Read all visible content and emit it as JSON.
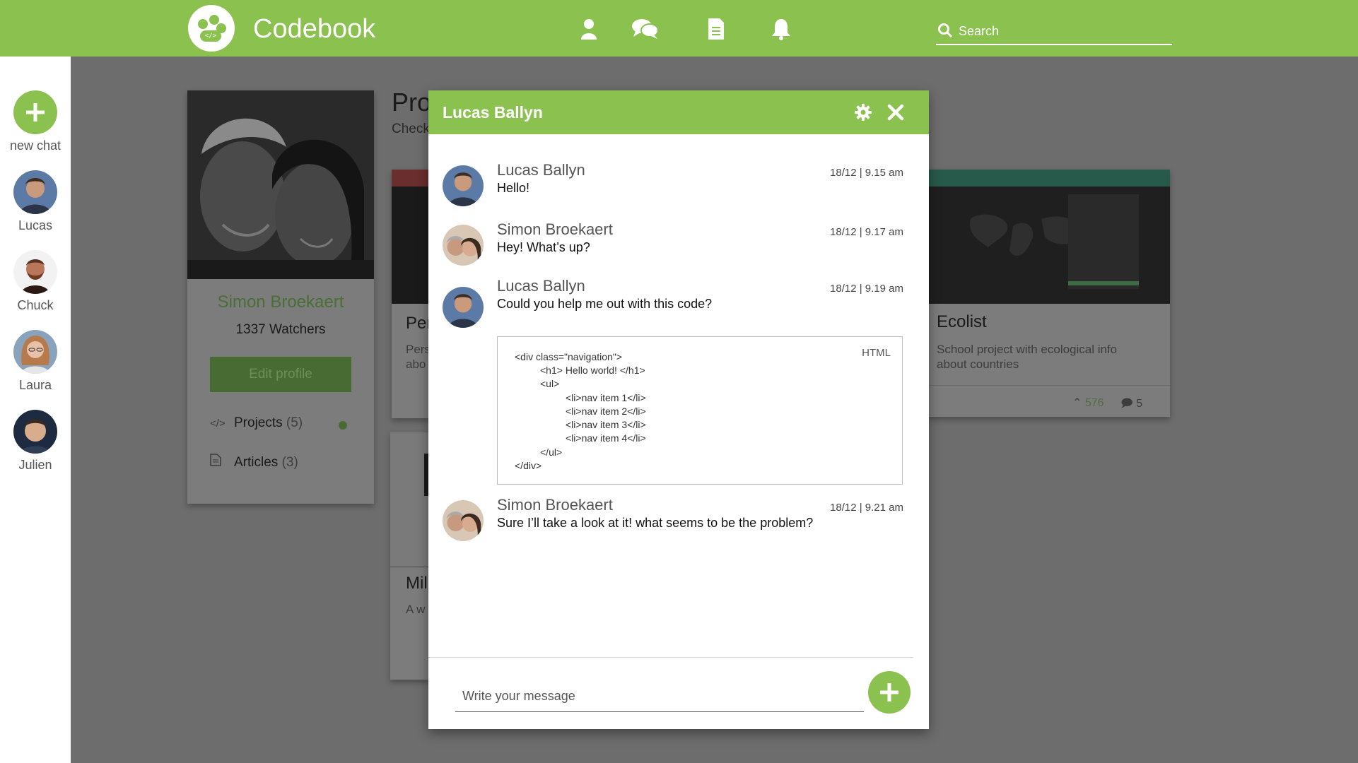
{
  "app": {
    "name": "Codebook"
  },
  "header": {
    "icons": [
      "user-icon",
      "chat-bubbles-icon",
      "document-icon",
      "bell-icon"
    ],
    "search_placeholder": "Search"
  },
  "sidebar": {
    "new_chat_label": "new chat",
    "contacts": [
      {
        "name": "Lucas"
      },
      {
        "name": "Chuck"
      },
      {
        "name": "Laura"
      },
      {
        "name": "Julien"
      }
    ]
  },
  "profile": {
    "name": "Simon Broekaert",
    "watchers": "1337 Watchers",
    "edit_label": "Edit profile",
    "menu": [
      {
        "label": "Projects",
        "count": "(5)"
      },
      {
        "label": "Articles",
        "count": "(3)"
      }
    ]
  },
  "page": {
    "title_visible": "Pro",
    "subtitle_visible": "Check"
  },
  "cards": [
    {
      "title_visible": "Per",
      "desc_visible": [
        "Pers",
        "abo"
      ]
    },
    {
      "title": "Ecolist",
      "desc": [
        "School project with ecological info",
        "about countries"
      ],
      "likes": "576",
      "comments": "5"
    },
    {
      "title_visible": "Mil",
      "desc_visible": "A w"
    }
  ],
  "chat": {
    "title": "Lucas Ballyn",
    "messages": [
      {
        "sender": "Lucas Ballyn",
        "time": "18/12 | 9.15 am",
        "text": "Hello!"
      },
      {
        "sender": "Simon Broekaert",
        "time": "18/12 | 9.17 am",
        "text": "Hey! What’s up?"
      },
      {
        "sender": "Lucas Ballyn",
        "time": "18/12 | 9.19 am",
        "text": "Could you help me out with this code?"
      },
      {
        "sender": "Simon Broekaert",
        "time": "18/12 | 9.21 am",
        "text": "Sure I’ll take a look at it! what seems to be the problem?"
      }
    ],
    "code_lang": "HTML",
    "code_lines": [
      "<div class=\"navigation\">",
      "<h1> Hello world! </h1>",
      "<ul>",
      "<li>nav item 1</li>",
      "<li>nav item 2</li>",
      "<li>nav item 3</li>",
      "<li>nav item 4</li>",
      "</ul>",
      "</div>"
    ],
    "input_placeholder": "Write your message"
  },
  "colors": {
    "brand": "#8bc14f",
    "overlay": "#6d6d6d",
    "brand_dim": "#486b33"
  }
}
